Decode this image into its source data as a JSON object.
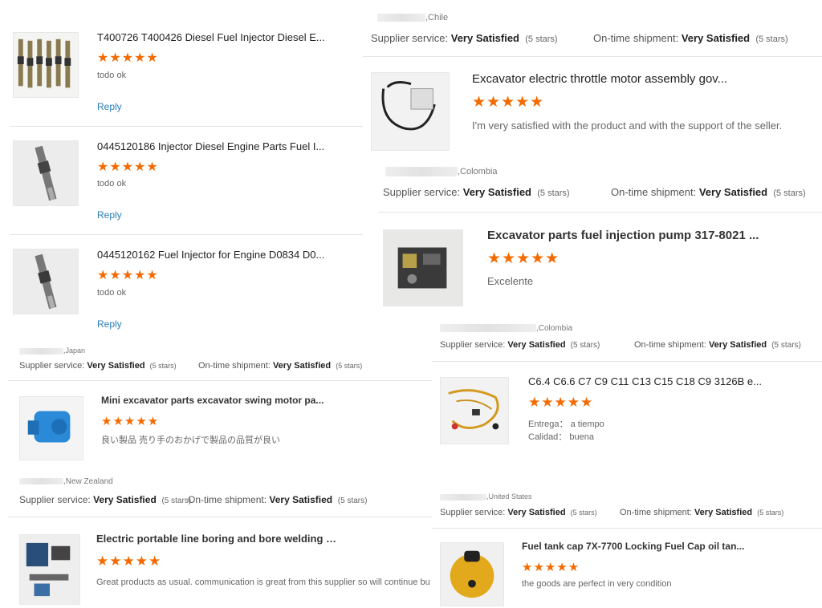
{
  "accent_color": "#f56a00",
  "link_color": "#2a7fb8",
  "star_icon": "star-icon",
  "left_reviews": [
    {
      "title": "T400726 T400426 Diesel Fuel Injector Diesel E...",
      "stars": "★★★★★",
      "comment": "todo ok",
      "reply": "Reply"
    },
    {
      "title": "0445120186 Injector Diesel Engine Parts Fuel I...",
      "stars": "★★★★★",
      "comment": "todo ok",
      "reply": "Reply"
    },
    {
      "title": "0445120162 Fuel Injector for Engine D0834 D0...",
      "stars": "★★★★★",
      "comment": "todo ok",
      "reply": "Reply"
    }
  ],
  "labels": {
    "supplier_service": "Supplier service:",
    "ontime_shipment": "On-time shipment:",
    "very_satisfied": "Very Satisfied",
    "five_stars": "(5 stars)"
  },
  "chile": {
    "country": ",Chile",
    "title": "Excavator electric throttle motor assembly gov...",
    "stars": "★★★★★",
    "comment": "I'm very satisfied with the product and with the support of the seller."
  },
  "colombia1": {
    "country": ",Colombia",
    "title": "Excavator parts fuel injection pump 317-8021 ...",
    "stars": "★★★★★",
    "comment": "Excelente"
  },
  "colombia2": {
    "country": ",Colombia",
    "title": "C6.4 C6.6 C7 C9 C11 C13 C15 C18 C9 3126B e...",
    "stars": "★★★★★",
    "line1": "Entrega： a tiempo",
    "line2": "Calidad： buena"
  },
  "japan": {
    "country": ",Japan",
    "title": "Mini excavator parts excavator swing motor pa...",
    "stars": "★★★★★",
    "comment": "良い製品 売り手のおかげで製品の品質が良い"
  },
  "newzealand": {
    "country": ",New Zealand",
    "title": "Electric portable line boring and bore welding li...",
    "stars": "★★★★★",
    "comment": "Great products as usual. communication is great from this supplier so will continue buying"
  },
  "unitedstates": {
    "country": ",United States",
    "title": "Fuel tank cap 7X-7700 Locking Fuel Cap oil tan...",
    "stars": "★★★★★",
    "comment": "the goods are perfect in very condition"
  }
}
